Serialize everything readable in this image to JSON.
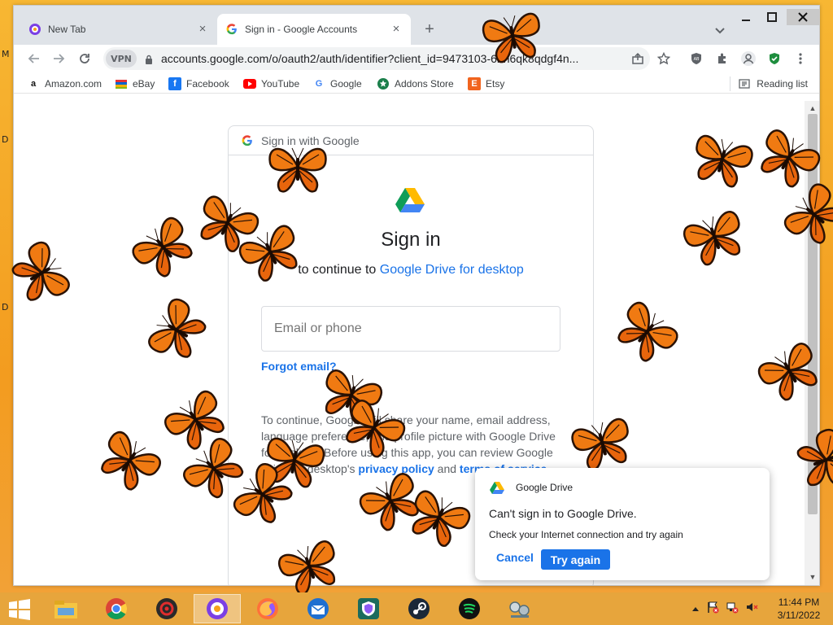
{
  "desktop": {
    "edge_letters": [
      "M",
      "D",
      "D"
    ]
  },
  "browser": {
    "tabs": [
      {
        "label": "New Tab",
        "icon": "new-tab-favicon",
        "active": false
      },
      {
        "label": "Sign in - Google Accounts",
        "icon": "google-g-icon",
        "active": true
      }
    ],
    "omnibox": {
      "vpn_label": "VPN",
      "url": "accounts.google.com/o/oauth2/auth/identifier?client_id=94731",
      "url_tail": "03-6bn6qk8qdgf4n..."
    },
    "bookmarks": [
      {
        "label": "Amazon.com",
        "icon": "amazon-icon"
      },
      {
        "label": "eBay",
        "icon": "ebay-icon"
      },
      {
        "label": "Facebook",
        "icon": "facebook-icon"
      },
      {
        "label": "YouTube",
        "icon": "youtube-icon"
      },
      {
        "label": "Google",
        "icon": "google-icon"
      },
      {
        "label": "Addons Store",
        "icon": "addons-store-icon"
      },
      {
        "label": "Etsy",
        "icon": "etsy-icon"
      }
    ],
    "reading_list_label": "Reading list"
  },
  "signin": {
    "header": "Sign in with Google",
    "title": "Sign in",
    "subtitle_prefix": "to continue to",
    "subtitle_app": "Google Drive for desktop",
    "email_placeholder": "Email or phone",
    "forgot_email": "Forgot email?",
    "consent_part1": "To continue, Google will share your name, email address, language preference, and profile picture with Google Drive for desktop. Before using this app, you can review Google Drive for desktop's",
    "privacy_policy": "privacy policy",
    "and": "and",
    "terms_of_service": "terms of service"
  },
  "toast": {
    "app_name": "Google Drive",
    "title": "Can't sign in to Google Drive.",
    "message": "Check your Internet connection and try again",
    "cancel_label": "Cancel",
    "retry_label": "Try again"
  },
  "taskbar": {
    "apps": [
      "file-explorer",
      "chrome",
      "avast-secure-browser",
      "avg-secure-browser",
      "firefox",
      "thunderbird",
      "avg-vpn",
      "steam",
      "spotify",
      "network-app"
    ],
    "active_app": "avg-secure-browser",
    "clock_time": "11:44 PM",
    "clock_date": "3/11/2022"
  },
  "colors": {
    "accent": "#1a73e8",
    "wallpaper": "#f6a623",
    "butterfly": "#f07a12"
  }
}
